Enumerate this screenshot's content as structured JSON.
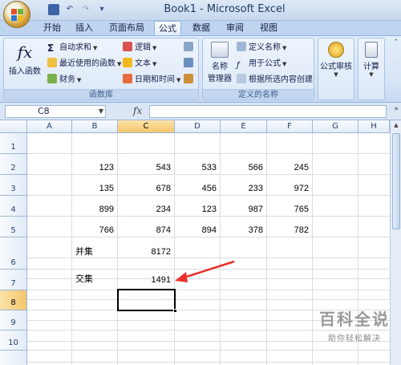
{
  "window": {
    "title": "Book1 - Microsoft Excel"
  },
  "ribbon_tabs": [
    "开始",
    "插入",
    "页面布局",
    "公式",
    "数据",
    "审阅",
    "视图"
  ],
  "active_tab": "公式",
  "groups": {
    "function_library": {
      "label": "函数库",
      "insert_function": "插入函数",
      "autosum": "自动求和",
      "recent": "最近使用的函数",
      "financial": "财务",
      "logical": "逻辑",
      "text": "文本",
      "datetime": "日期和时间"
    },
    "defined_names": {
      "label": "定义的名称",
      "name_manager_line1": "名称",
      "name_manager_line2": "管理器",
      "define_name": "定义名称",
      "use_in_formula": "用于公式",
      "create_from_selection": "根据所选内容创建"
    },
    "formula_auditing": {
      "label": "公式审核"
    },
    "calculation": {
      "label": "计算"
    }
  },
  "formula_bar": {
    "name_box": "C8",
    "fx": "fx",
    "formula": ""
  },
  "columns": [
    "A",
    "B",
    "C",
    "D",
    "E",
    "F",
    "G",
    "H"
  ],
  "selected_column": "C",
  "rows": [
    "1",
    "2",
    "3",
    "4",
    "5",
    "6",
    "7",
    "8",
    "9",
    "10"
  ],
  "selected_row": "8",
  "cells": {
    "row2": [
      "123",
      "543",
      "533",
      "566",
      "245"
    ],
    "row3": [
      "135",
      "678",
      "456",
      "233",
      "972"
    ],
    "row4": [
      "899",
      "234",
      "123",
      "987",
      "765"
    ],
    "row5": [
      "766",
      "874",
      "894",
      "378",
      "782"
    ],
    "b6": "并集",
    "c6": "8172",
    "b7": "交集",
    "c7": "1491"
  },
  "arrow_color": "#e8302a",
  "watermark": {
    "title": "百科全说",
    "subtitle": "助你轻松解决"
  }
}
